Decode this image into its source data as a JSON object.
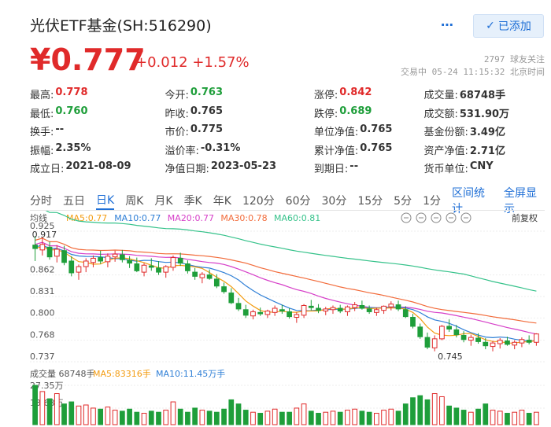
{
  "header": {
    "title": "光伏ETF基金(SH:516290)",
    "more_icon": "⋯",
    "follow_label": "已添加",
    "price": "¥0.777",
    "change": "+0.012 +1.57%",
    "followers": "2797 球友关注",
    "status": "交易中 05-24 11:15:32 北京时间"
  },
  "quote": [
    [
      {
        "label": "最高:",
        "value": "0.778",
        "color": "red"
      },
      {
        "label": "今开:",
        "value": "0.763",
        "color": "green"
      },
      {
        "label": "涨停:",
        "value": "0.842",
        "color": "red"
      },
      {
        "label": "成交量:",
        "value": "68748手",
        "color": ""
      }
    ],
    [
      {
        "label": "最低:",
        "value": "0.760",
        "color": "green"
      },
      {
        "label": "昨收:",
        "value": "0.765",
        "color": ""
      },
      {
        "label": "跌停:",
        "value": "0.689",
        "color": "green"
      },
      {
        "label": "成交额:",
        "value": "531.90万",
        "color": ""
      }
    ],
    [
      {
        "label": "换手:",
        "value": "--",
        "color": ""
      },
      {
        "label": "市价:",
        "value": "0.775",
        "color": ""
      },
      {
        "label": "单位净值:",
        "value": "0.765",
        "color": ""
      },
      {
        "label": "基金份额:",
        "value": "3.49亿",
        "color": ""
      }
    ],
    [
      {
        "label": "振幅:",
        "value": "2.35%",
        "color": ""
      },
      {
        "label": "溢价率:",
        "value": "-0.31%",
        "color": ""
      },
      {
        "label": "累计净值:",
        "value": "0.765",
        "color": ""
      },
      {
        "label": "资产净值:",
        "value": "2.71亿",
        "color": ""
      }
    ],
    [
      {
        "label": "成立日:",
        "value": "2021-08-09",
        "color": ""
      },
      {
        "label": "净值日期:",
        "value": "2023-05-23",
        "color": ""
      },
      {
        "label": "到期日:",
        "value": "--",
        "color": ""
      },
      {
        "label": "货币单位:",
        "value": "CNY",
        "color": ""
      }
    ]
  ],
  "tabs": [
    "分时",
    "五日",
    "日K",
    "周K",
    "月K",
    "季K",
    "年K",
    "120分",
    "60分",
    "30分",
    "15分",
    "5分",
    "1分"
  ],
  "active_tab": 2,
  "tab_links": [
    "区间统计",
    "全屏显示"
  ],
  "chart_toolbar": {
    "ma_label": "均线",
    "fq_label": "前复权"
  },
  "ma_legend": [
    {
      "label": "MA5:0.77",
      "color": "#f39c12"
    },
    {
      "label": "MA10:0.77",
      "color": "#2f7fd6"
    },
    {
      "label": "MA20:0.77",
      "color": "#d63fc8"
    },
    {
      "label": "MA30:0.78",
      "color": "#f26b3a"
    },
    {
      "label": "MA60:0.81",
      "color": "#35c28a"
    }
  ],
  "vol_legend": [
    {
      "label": "成交量 68748手",
      "color": "#555555"
    },
    {
      "label": "MA5:83316手",
      "color": "#f39c12"
    },
    {
      "label": "MA10:11.45万手",
      "color": "#2f7fd6"
    }
  ],
  "colors": {
    "up": "#e02a2a",
    "down": "#1e9e3a",
    "accent": "#1f6fd6"
  },
  "chart_data": {
    "type": "candlestick",
    "y_ticks": [
      "0.925",
      "0.862",
      "0.831",
      "0.800",
      "0.768",
      "0.737"
    ],
    "ylim": [
      0.737,
      0.925
    ],
    "annotations": {
      "high": "0.917",
      "low": "0.745"
    },
    "candles": [
      [
        0.905,
        0.918,
        0.882,
        0.9
      ],
      [
        0.898,
        0.917,
        0.89,
        0.906
      ],
      [
        0.902,
        0.91,
        0.884,
        0.888
      ],
      [
        0.889,
        0.905,
        0.88,
        0.899
      ],
      [
        0.897,
        0.904,
        0.876,
        0.88
      ],
      [
        0.882,
        0.889,
        0.86,
        0.865
      ],
      [
        0.866,
        0.877,
        0.855,
        0.874
      ],
      [
        0.874,
        0.886,
        0.866,
        0.882
      ],
      [
        0.88,
        0.89,
        0.873,
        0.886
      ],
      [
        0.887,
        0.897,
        0.878,
        0.882
      ],
      [
        0.881,
        0.893,
        0.873,
        0.889
      ],
      [
        0.888,
        0.897,
        0.881,
        0.892
      ],
      [
        0.891,
        0.898,
        0.88,
        0.884
      ],
      [
        0.883,
        0.889,
        0.872,
        0.879
      ],
      [
        0.878,
        0.887,
        0.866,
        0.868
      ],
      [
        0.866,
        0.879,
        0.86,
        0.876
      ],
      [
        0.875,
        0.886,
        0.868,
        0.873
      ],
      [
        0.872,
        0.882,
        0.862,
        0.866
      ],
      [
        0.866,
        0.876,
        0.858,
        0.874
      ],
      [
        0.873,
        0.89,
        0.868,
        0.887
      ],
      [
        0.886,
        0.894,
        0.875,
        0.879
      ],
      [
        0.878,
        0.883,
        0.864,
        0.868
      ],
      [
        0.866,
        0.872,
        0.855,
        0.86
      ],
      [
        0.858,
        0.866,
        0.85,
        0.863
      ],
      [
        0.862,
        0.87,
        0.855,
        0.857
      ],
      [
        0.856,
        0.863,
        0.843,
        0.846
      ],
      [
        0.845,
        0.851,
        0.835,
        0.838
      ],
      [
        0.836,
        0.843,
        0.82,
        0.822
      ],
      [
        0.821,
        0.829,
        0.81,
        0.813
      ],
      [
        0.812,
        0.819,
        0.8,
        0.804
      ],
      [
        0.803,
        0.812,
        0.798,
        0.809
      ],
      [
        0.808,
        0.815,
        0.803,
        0.806
      ],
      [
        0.805,
        0.812,
        0.8,
        0.81
      ],
      [
        0.808,
        0.818,
        0.803,
        0.814
      ],
      [
        0.812,
        0.819,
        0.806,
        0.81
      ],
      [
        0.809,
        0.814,
        0.799,
        0.802
      ],
      [
        0.801,
        0.808,
        0.793,
        0.805
      ],
      [
        0.804,
        0.82,
        0.8,
        0.818
      ],
      [
        0.817,
        0.826,
        0.811,
        0.815
      ],
      [
        0.814,
        0.82,
        0.807,
        0.811
      ],
      [
        0.81,
        0.816,
        0.804,
        0.813
      ],
      [
        0.812,
        0.818,
        0.806,
        0.815
      ],
      [
        0.814,
        0.819,
        0.807,
        0.81
      ],
      [
        0.809,
        0.818,
        0.803,
        0.816
      ],
      [
        0.815,
        0.823,
        0.81,
        0.819
      ],
      [
        0.818,
        0.825,
        0.812,
        0.814
      ],
      [
        0.813,
        0.818,
        0.806,
        0.809
      ],
      [
        0.808,
        0.815,
        0.803,
        0.812
      ],
      [
        0.811,
        0.818,
        0.806,
        0.817
      ],
      [
        0.816,
        0.824,
        0.811,
        0.82
      ],
      [
        0.819,
        0.825,
        0.81,
        0.813
      ],
      [
        0.812,
        0.817,
        0.8,
        0.802
      ],
      [
        0.801,
        0.806,
        0.785,
        0.788
      ],
      [
        0.787,
        0.792,
        0.77,
        0.773
      ],
      [
        0.772,
        0.779,
        0.755,
        0.758
      ],
      [
        0.757,
        0.775,
        0.752,
        0.77
      ],
      [
        0.77,
        0.79,
        0.768,
        0.788
      ],
      [
        0.788,
        0.798,
        0.78,
        0.784
      ],
      [
        0.783,
        0.79,
        0.772,
        0.776
      ],
      [
        0.775,
        0.781,
        0.765,
        0.769
      ],
      [
        0.768,
        0.776,
        0.76,
        0.772
      ],
      [
        0.771,
        0.778,
        0.763,
        0.766
      ],
      [
        0.765,
        0.771,
        0.755,
        0.76
      ],
      [
        0.759,
        0.767,
        0.752,
        0.764
      ],
      [
        0.763,
        0.771,
        0.756,
        0.768
      ],
      [
        0.767,
        0.773,
        0.76,
        0.762
      ],
      [
        0.761,
        0.768,
        0.755,
        0.765
      ],
      [
        0.764,
        0.772,
        0.758,
        0.769
      ],
      [
        0.768,
        0.775,
        0.762,
        0.765
      ],
      [
        0.765,
        0.778,
        0.76,
        0.777
      ]
    ],
    "volumes": [
      38,
      32,
      25,
      30,
      20,
      22,
      18,
      19,
      16,
      15,
      17,
      14,
      13,
      15,
      12,
      11,
      13,
      12,
      14,
      22,
      15,
      12,
      16,
      14,
      13,
      12,
      15,
      24,
      20,
      14,
      12,
      11,
      13,
      15,
      12,
      12,
      16,
      20,
      13,
      11,
      12,
      13,
      12,
      14,
      15,
      13,
      12,
      11,
      14,
      15,
      13,
      20,
      26,
      28,
      24,
      30,
      27,
      18,
      16,
      14,
      12,
      15,
      20,
      14,
      13,
      11,
      12,
      14,
      11,
      12
    ],
    "vol_ticks": [
      "27.35万",
      "13.68万"
    ]
  }
}
